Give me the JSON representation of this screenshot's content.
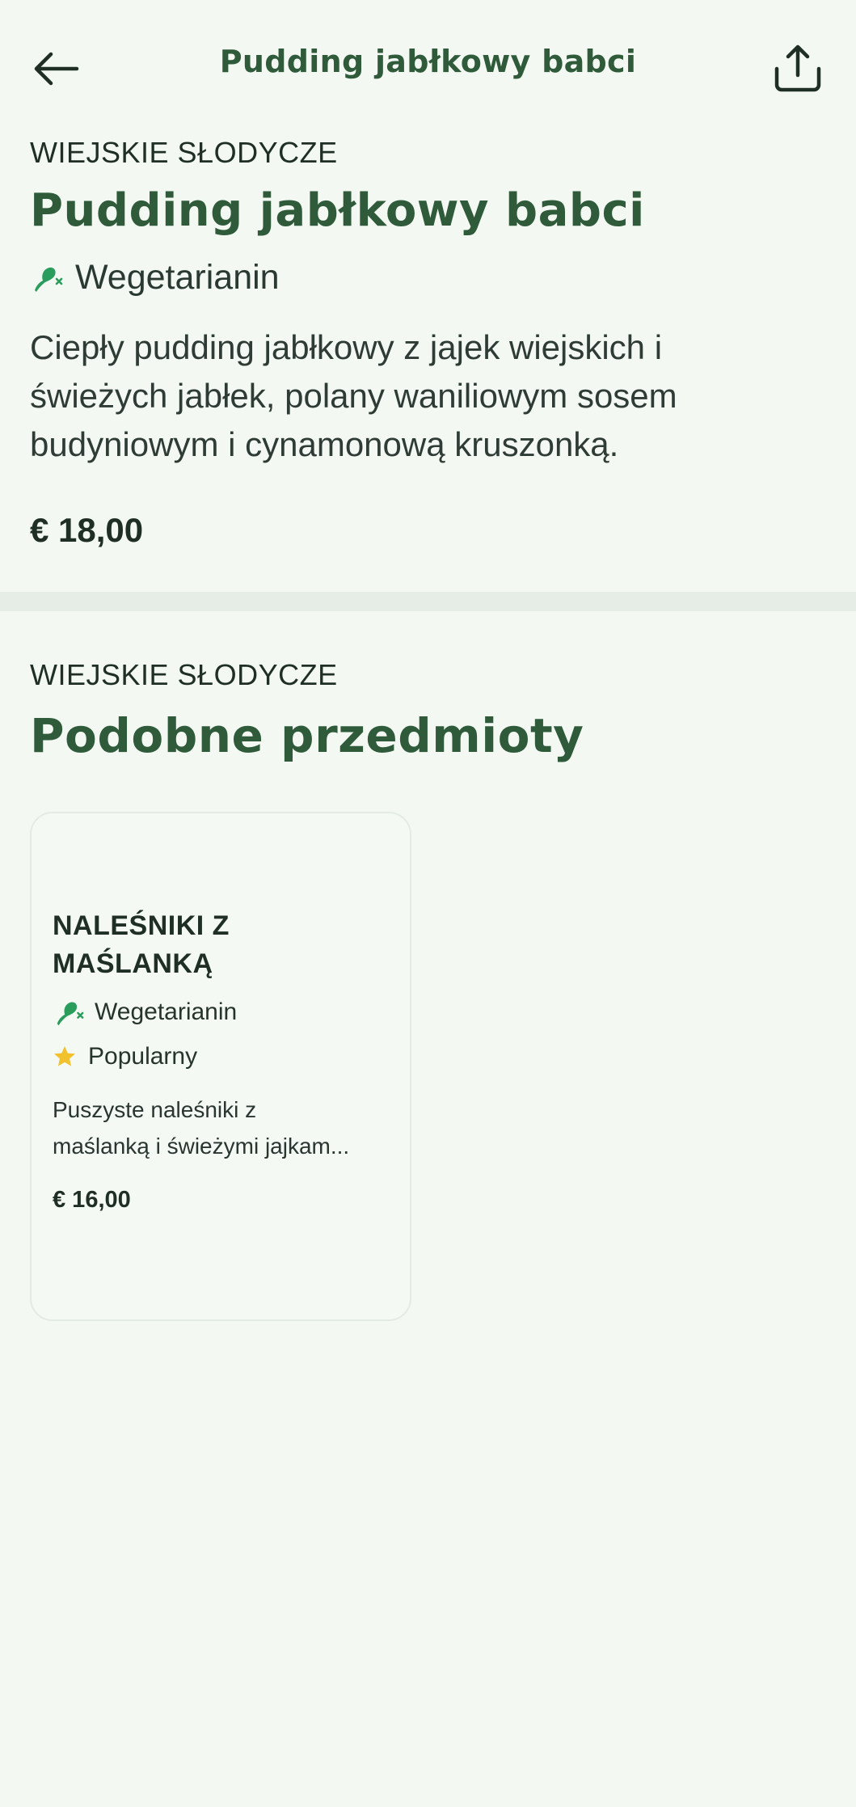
{
  "header": {
    "title": "Pudding jabłkowy babci",
    "back_icon": "arrow-left-icon",
    "share_icon": "share-icon"
  },
  "item": {
    "category": "WIEJSKIE SŁODYCZE",
    "title": "Pudding jabłkowy babci",
    "tag": {
      "label": "Wegetarianin",
      "icon": "vegetarian-icon"
    },
    "description": "Ciepły pudding jabłkowy z jajek wiejskich i świeżych jabłek, polany waniliowym sosem budyniowym i cynamonową kruszonką.",
    "price": "€ 18,00"
  },
  "similar": {
    "category": "WIEJSKIE SŁODYCZE",
    "title": "Podobne przedmioty",
    "cards": [
      {
        "title_line1": "NALEŚNIKI Z",
        "title_line2": "MAŚLANKĄ",
        "tags": [
          {
            "label": "Wegetarianin",
            "icon": "vegetarian-icon"
          },
          {
            "label": "Popularny",
            "icon": "star-icon"
          }
        ],
        "description_line1": "Puszyste naleśniki z",
        "description_line2": "maślanką i świeżymi jajkam...",
        "price": "€ 16,00"
      }
    ]
  },
  "colors": {
    "background": "#f3f8f3",
    "accent_green": "#2f5b3a",
    "vegetarian_green": "#2a9d5c",
    "star_yellow": "#f2c12e",
    "divider": "#e6ede7"
  }
}
